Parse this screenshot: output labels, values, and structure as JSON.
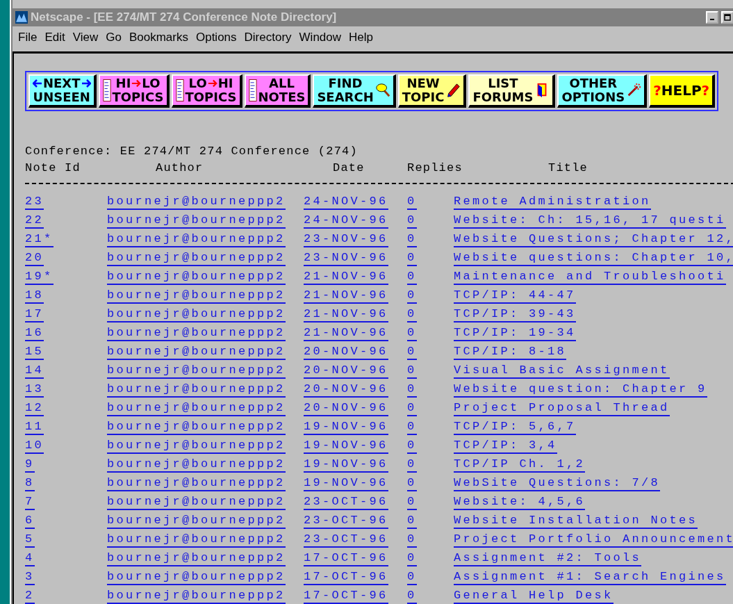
{
  "window": {
    "title": "Netscape - [EE 274/MT 274 Conference Note Directory]"
  },
  "menu": [
    "File",
    "Edit",
    "View",
    "Go",
    "Bookmarks",
    "Options",
    "Directory",
    "Window",
    "Help"
  ],
  "toolbar": [
    {
      "kind": "next",
      "line1": "NEXT",
      "line2": "UNSEEN",
      "color": "#7fffff"
    },
    {
      "kind": "order",
      "line1": [
        "HI",
        "LO"
      ],
      "line2": "TOPICS",
      "color": "#ff80ff"
    },
    {
      "kind": "order",
      "line1": [
        "LO",
        "HI"
      ],
      "line2": "TOPICS",
      "color": "#ff80ff"
    },
    {
      "kind": "all",
      "line1": "ALL",
      "line2": "NOTES",
      "color": "#ff80ff"
    },
    {
      "kind": "find",
      "line1": "FIND",
      "line2": "SEARCH",
      "color": "#7fffff"
    },
    {
      "kind": "new",
      "line1": "NEW",
      "line2": "TOPIC",
      "color": "#ffff80"
    },
    {
      "kind": "list",
      "line1": "LIST",
      "line2": "FORUMS",
      "color": "#ffffc0"
    },
    {
      "kind": "other",
      "line1": "OTHER",
      "line2": "OPTIONS",
      "color": "#7fffff"
    },
    {
      "kind": "help",
      "line1": "?HELP?",
      "color": "#ffff00"
    }
  ],
  "conference": "Conference: EE 274/MT 274 Conference (274)",
  "columns": [
    "Note Id",
    "Author",
    "Date",
    "Replies",
    "Title"
  ],
  "rows": [
    {
      "id": "23",
      "author": "bournejr@bourneppp2",
      "date": "24-NOV-96",
      "replies": "0",
      "title": "Remote Administration"
    },
    {
      "id": "22",
      "author": "bournejr@bourneppp2",
      "date": "24-NOV-96",
      "replies": "0",
      "title": "Website: Ch: 15,16, 17 questi"
    },
    {
      "id": "21*",
      "author": "bournejr@bourneppp2",
      "date": "23-NOV-96",
      "replies": "0",
      "title": "Website Questions; Chapter 12,"
    },
    {
      "id": "20",
      "author": "bournejr@bourneppp2",
      "date": "23-NOV-96",
      "replies": "0",
      "title": "Website questions: Chapter 10,"
    },
    {
      "id": "19*",
      "author": "bournejr@bourneppp2",
      "date": "21-NOV-96",
      "replies": "0",
      "title": "Maintenance and Troubleshooti"
    },
    {
      "id": "18",
      "author": "bournejr@bourneppp2",
      "date": "21-NOV-96",
      "replies": "0",
      "title": "TCP/IP: 44-47"
    },
    {
      "id": "17",
      "author": "bournejr@bourneppp2",
      "date": "21-NOV-96",
      "replies": "0",
      "title": "TCP/IP: 39-43"
    },
    {
      "id": "16",
      "author": "bournejr@bourneppp2",
      "date": "21-NOV-96",
      "replies": "0",
      "title": "TCP/IP: 19-34"
    },
    {
      "id": "15",
      "author": "bournejr@bourneppp2",
      "date": "20-NOV-96",
      "replies": "0",
      "title": "TCP/IP: 8-18"
    },
    {
      "id": "14",
      "author": "bournejr@bourneppp2",
      "date": "20-NOV-96",
      "replies": "0",
      "title": "Visual Basic Assignment"
    },
    {
      "id": "13",
      "author": "bournejr@bourneppp2",
      "date": "20-NOV-96",
      "replies": "0",
      "title": "Website question: Chapter 9"
    },
    {
      "id": "12",
      "author": "bournejr@bourneppp2",
      "date": "20-NOV-96",
      "replies": "0",
      "title": "Project Proposal Thread"
    },
    {
      "id": "11",
      "author": "bournejr@bourneppp2",
      "date": "19-NOV-96",
      "replies": "0",
      "title": "TCP/IP: 5,6,7"
    },
    {
      "id": "10",
      "author": "bournejr@bourneppp2",
      "date": "19-NOV-96",
      "replies": "0",
      "title": "TCP/IP: 3,4"
    },
    {
      "id": "9",
      "author": "bournejr@bourneppp2",
      "date": "19-NOV-96",
      "replies": "0",
      "title": "TCP/IP Ch. 1,2"
    },
    {
      "id": "8",
      "author": "bournejr@bourneppp2",
      "date": "19-NOV-96",
      "replies": "0",
      "title": "WebSite Questions: 7/8"
    },
    {
      "id": "7",
      "author": "bournejr@bourneppp2",
      "date": "23-OCT-96",
      "replies": "0",
      "title": "Website: 4,5,6"
    },
    {
      "id": "6",
      "author": "bournejr@bourneppp2",
      "date": "23-OCT-96",
      "replies": "0",
      "title": "Website Installation Notes"
    },
    {
      "id": "5",
      "author": "bournejr@bourneppp2",
      "date": "23-OCT-96",
      "replies": "0",
      "title": "Project Portfolio Announcement"
    },
    {
      "id": "4",
      "author": "bournejr@bourneppp2",
      "date": "17-OCT-96",
      "replies": "0",
      "title": "Assignment #2: Tools"
    },
    {
      "id": "3",
      "author": "bournejr@bourneppp2",
      "date": "17-OCT-96",
      "replies": "0",
      "title": "Assignment #1: Search Engines"
    },
    {
      "id": "2",
      "author": "bournejr@bourneppp2",
      "date": "17-OCT-96",
      "replies": "0",
      "title": "General Help Desk"
    }
  ]
}
